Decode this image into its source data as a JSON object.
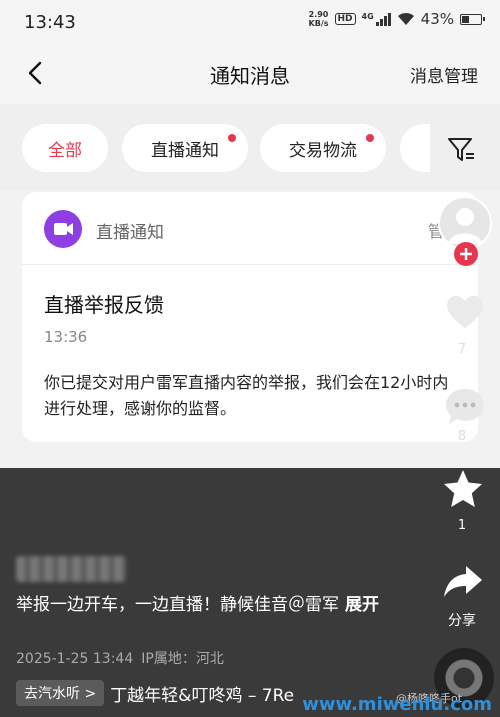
{
  "status_bar": {
    "time": "13:43",
    "net_speed_value": "2.90",
    "net_speed_unit": "KB/s",
    "hd": "HD",
    "signal_label": "4G",
    "battery": "43%",
    "battery_level": 0.43
  },
  "nav": {
    "title": "通知消息",
    "manage": "消息管理"
  },
  "tabs": [
    {
      "label": "全部",
      "active": true
    },
    {
      "label": "直播通知",
      "unread": true
    },
    {
      "label": "交易物流",
      "unread": true
    }
  ],
  "card": {
    "category": "直播通知",
    "manage": "管",
    "title": "直播举报反馈",
    "time": "13:36",
    "body": "你已提交对用户雷军直播内容的举报，我们会在12小时内进行处理，感谢你的监督。"
  },
  "video": {
    "description": "举报一边开车，一边直播！静候佳音＠雷军",
    "expand": "展开",
    "date": "2025-1-25 13:44",
    "location": "IP属地：河北",
    "music_chip": "去汽水听 >",
    "music_title": "丁越年轻&叮咚鸡 – 7Re"
  },
  "side": {
    "like_count": "7",
    "comment_count": "8",
    "favorite_count": "1",
    "share_label": "分享"
  },
  "watermark": {
    "site": "www.miwenlu.com",
    "account": "@杨咚咚手ot"
  },
  "colors": {
    "accent": "#e5364e",
    "live_icon": "#8f3ee3"
  }
}
